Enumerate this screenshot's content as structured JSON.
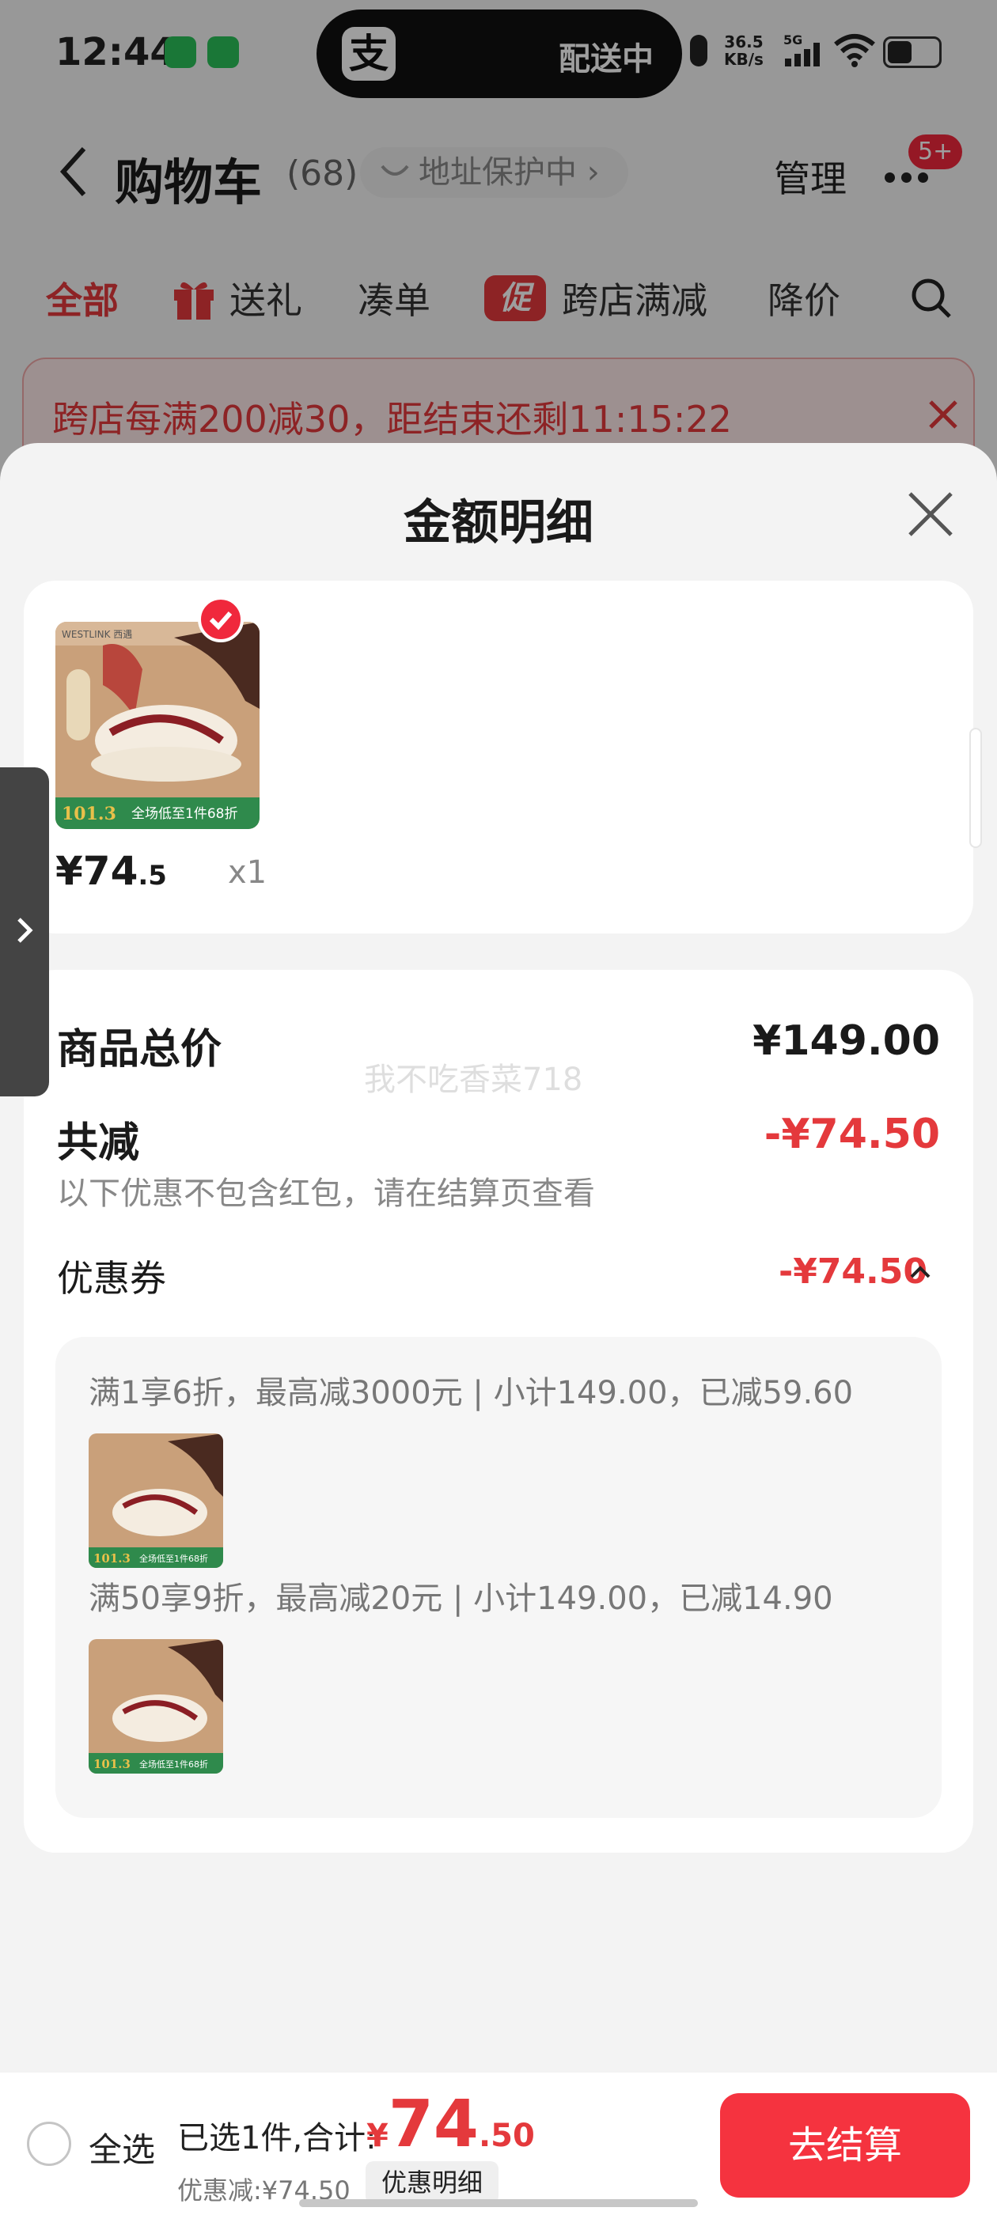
{
  "status_bar": {
    "time": "12:44",
    "island_text": "配送中",
    "alipay_glyph": "支",
    "net_speed_value": "36.5",
    "net_speed_unit": "KB/s",
    "signal": "5G"
  },
  "nav": {
    "title": "购物车",
    "count": "(68)",
    "address_protect": "地址保护中",
    "manage": "管理",
    "badge": "5+"
  },
  "tabs": [
    "全部",
    "送礼",
    "凑单",
    "跨店满减",
    "降价"
  ],
  "promo_badge": "促",
  "promo_banner": {
    "text": "跨店每满200减30，距结束还剩11:15:22"
  },
  "sheet": {
    "title": "金额明细",
    "product": {
      "brand": "WESTLINK 西遇",
      "img_price": "101.3",
      "img_promo": "全场低至1件68折",
      "price_main": "¥74",
      "price_decimal": ".5",
      "qty": "x1"
    },
    "watermark": "我不吃香菜718",
    "total_label": "商品总价",
    "total_value": "¥149.00",
    "discount_label": "共减",
    "discount_value": "-¥74.50",
    "note": "以下优惠不包含红包，请在结算页查看",
    "coupon_label": "优惠券",
    "coupon_value": "-¥74.50",
    "coupon_rules": [
      "满1享6折，最高减3000元 | 小计149.00，已减59.60",
      "满50享9折，最高减20元 | 小计149.00，已减14.90"
    ]
  },
  "bottom_bar": {
    "select_all": "全选",
    "selected": "已选1件,合计:",
    "currency": "¥",
    "total_main": "74",
    "total_decimal": ".50",
    "discount": "优惠减:¥74.50",
    "detail_button": "优惠明细",
    "checkout": "去结算"
  },
  "colors": {
    "accent_red": "#e4393c",
    "checkout_red": "#f5333f",
    "wechat_green": "#2bc15a"
  }
}
